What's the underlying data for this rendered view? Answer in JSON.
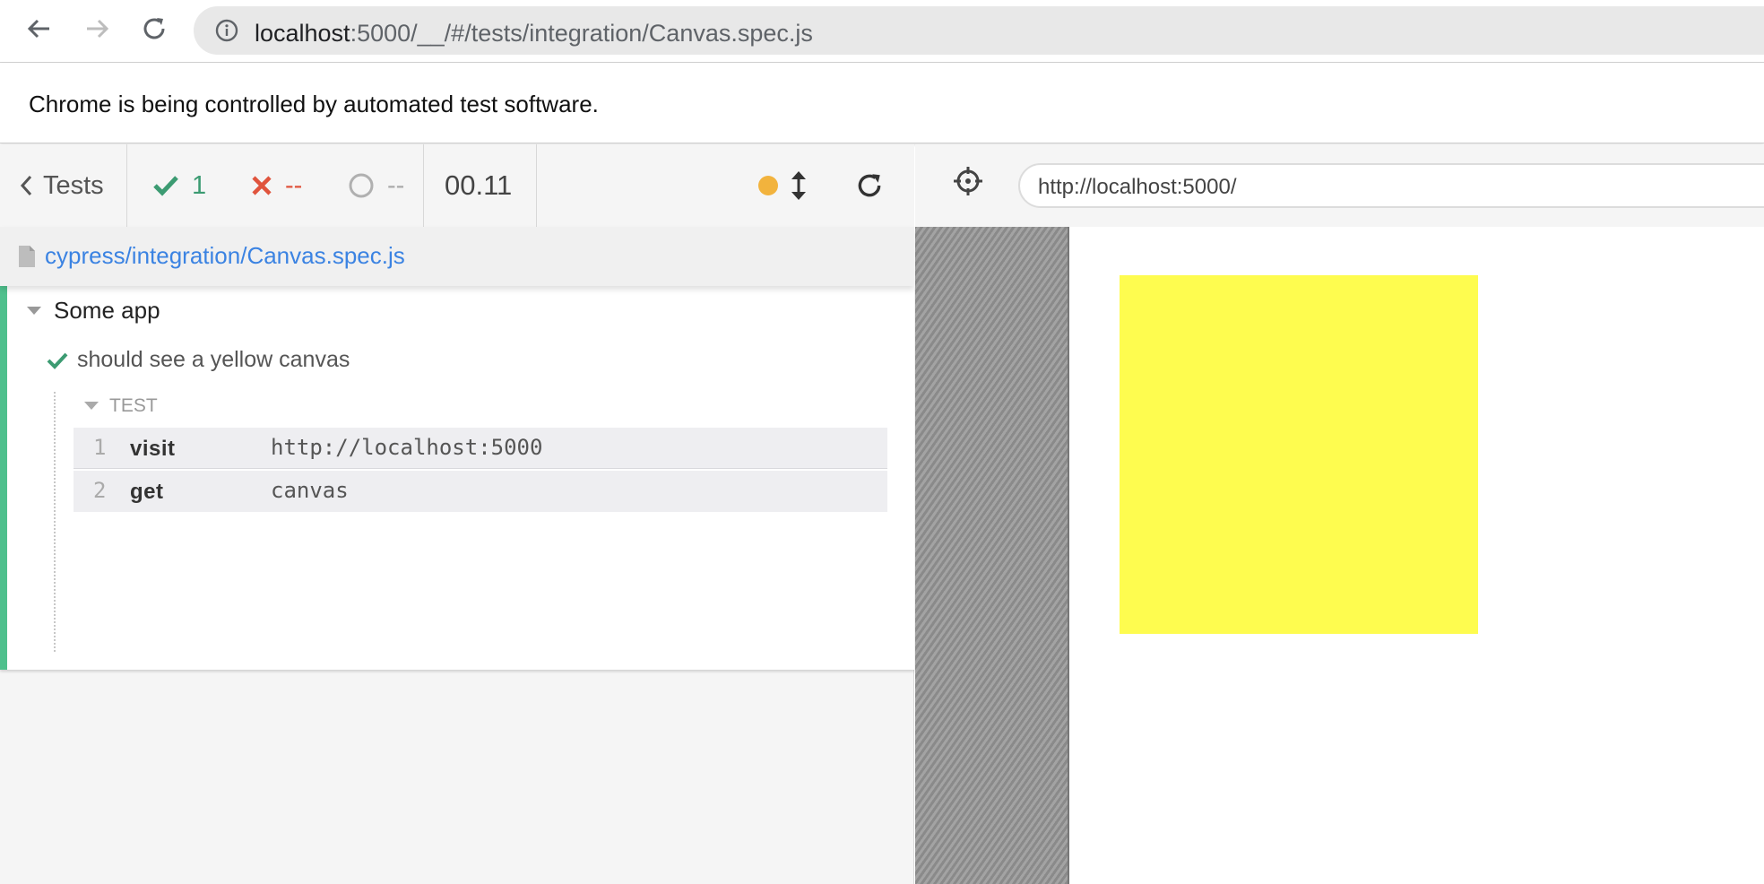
{
  "browser": {
    "url_host": "localhost",
    "url_rest": ":5000/__/#/tests/integration/Canvas.spec.js",
    "automation_notice": "Chrome is being controlled by automated test software."
  },
  "reporter": {
    "tests_label": "Tests",
    "passed_count": "1",
    "failed_count": "--",
    "pending_count": "--",
    "duration": "00.11",
    "spec_path": "cypress/integration/Canvas.spec.js",
    "suite_title": "Some app",
    "test_title": "should see a yellow canvas",
    "hook_title": "TEST",
    "commands": [
      {
        "num": "1",
        "name": "visit",
        "message": "http://localhost:5000"
      },
      {
        "num": "2",
        "name": "get",
        "message": "canvas"
      }
    ]
  },
  "aut": {
    "url": "http://localhost:5000/",
    "canvas_color": "#fefc4f"
  },
  "colors": {
    "passed": "#3c9b72",
    "failed": "#e0543d",
    "running_dot": "#f2b33d",
    "link": "#3b83e2"
  },
  "icons": [
    "back-arrow-icon",
    "forward-arrow-icon",
    "reload-icon",
    "info-icon",
    "chevron-left-icon",
    "check-icon",
    "x-icon",
    "spinner-icon",
    "resize-vertical-icon",
    "file-icon",
    "caret-down-icon",
    "crosshair-icon"
  ]
}
